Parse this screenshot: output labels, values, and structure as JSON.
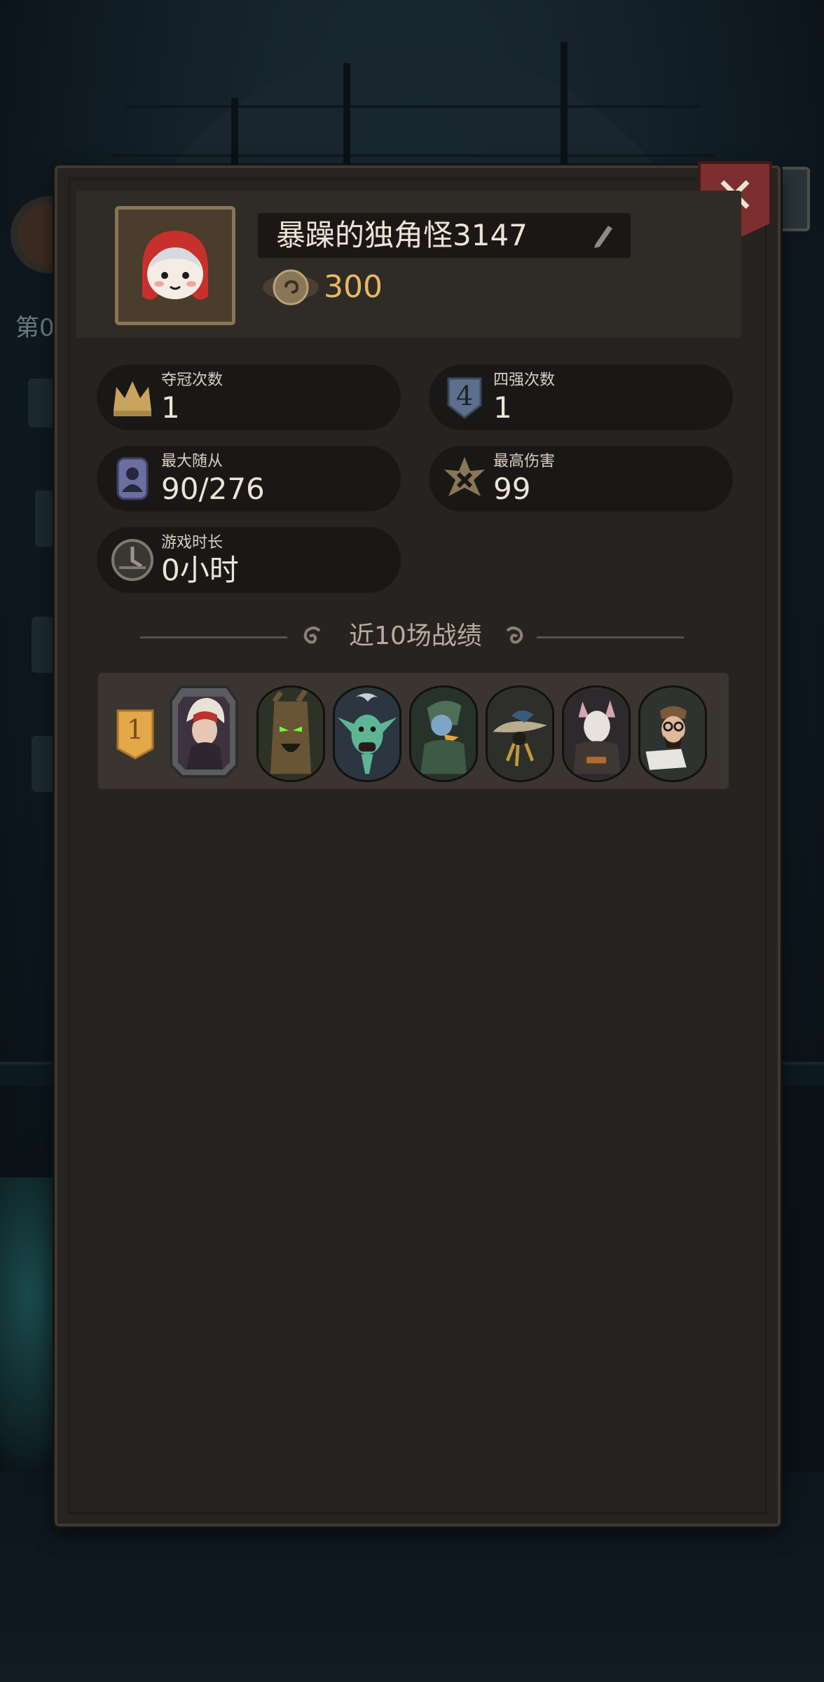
{
  "profile": {
    "player_name": "暴躁的独角怪3147",
    "coins": "300"
  },
  "stats": [
    {
      "label": "夺冠次数",
      "value": "1",
      "icon": "crown-icon"
    },
    {
      "label": "四强次数",
      "value": "1",
      "icon": "top-four-shield-icon"
    },
    {
      "label": "最大随从",
      "value": "90/276",
      "icon": "minion-card-icon"
    },
    {
      "label": "最高伤害",
      "value": "99",
      "icon": "damage-star-icon"
    },
    {
      "label": "游戏时长",
      "value": "0小时",
      "icon": "clock-icon"
    }
  ],
  "recent": {
    "title": "近10场战绩",
    "matches": [
      {
        "rank": "1",
        "hero": "red-hood-witch-hero",
        "minions": [
          "angry-treant",
          "green-goblin",
          "goblin-knight",
          "mushroom-creature",
          "rat-rogue",
          "bearded-scholar"
        ]
      }
    ]
  },
  "background": {
    "side_label": "第0"
  },
  "colors": {
    "panel": "#262320",
    "accent_gold": "#e8b964",
    "close_red": "#7b2f2e"
  }
}
